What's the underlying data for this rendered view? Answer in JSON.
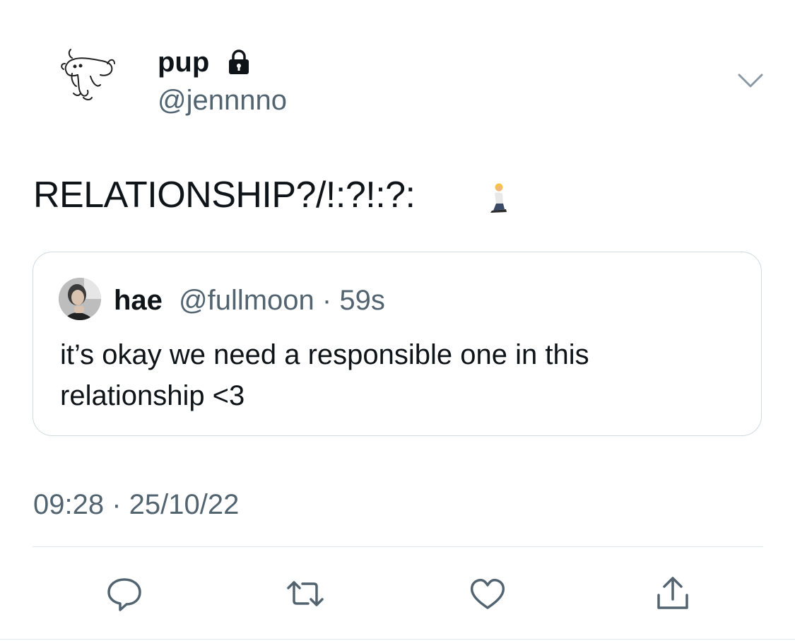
{
  "author": {
    "name": "pup",
    "handle": "@jennnno"
  },
  "tweet": {
    "text": "RELATIONSHIP?/!:?!:?:",
    "emoji_icon": "person-kneeling-icon",
    "timestamp": "09:28 · 25/10/22"
  },
  "quote": {
    "name": "hae",
    "handle_time": "@fullmoon · 59s",
    "text": "it’s okay we need a responsible one in this relationship <3"
  },
  "actions": [
    "reply-icon",
    "retweet-icon",
    "like-icon",
    "share-icon"
  ],
  "colors": {
    "text": "#0f1419",
    "secondary": "#536471",
    "border": "#cfd9de",
    "icon": "#536471"
  }
}
